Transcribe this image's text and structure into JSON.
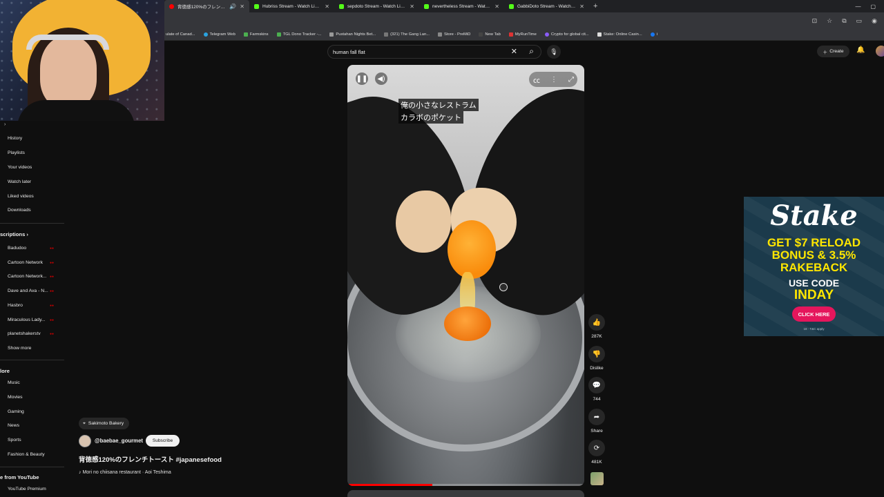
{
  "browser": {
    "tabs": [
      {
        "title": "背徳感120%のフレンチトースト",
        "favicon": "youtube-icon",
        "active": true
      },
      {
        "title": "Hubriss Stream - Watch Live o",
        "favicon": "kick-icon",
        "active": false
      },
      {
        "title": "sepdoto Stream - Watch Live o",
        "favicon": "kick-icon",
        "active": false
      },
      {
        "title": "nevertheless Stream - Watch Li",
        "favicon": "kick-icon",
        "active": false
      },
      {
        "title": "GabbiDoto Stream - Watch Live",
        "favicon": "kick-icon",
        "active": false
      }
    ],
    "new_tab": "+",
    "bookmarks": [
      "ulate of Canad...",
      "Telegram Web",
      "Farmskins",
      "TGL Dono Tracker -...",
      "Pustahan Nights Bet...",
      "(321) The Gang Lan...",
      "Store - PreMiD",
      "New Tab",
      "MyRunTime",
      "Crypto for global cit...",
      "Stake: Online Casin...",
      "i"
    ]
  },
  "masthead": {
    "search_value": "human fall flat",
    "create_label": "Create"
  },
  "sidebar": {
    "you_items": [
      "History",
      "Playlists",
      "Your videos",
      "Watch later",
      "Liked videos",
      "Downloads"
    ],
    "subscriptions_title": "scriptions",
    "subscriptions": [
      "Badudoo",
      "Cartoon Network",
      "Cartoon Network...",
      "Dave and Ava - N...",
      "Hasbro",
      "Miraculous Lady...",
      "planetshakerstv"
    ],
    "show_more": "Show more",
    "explore_title": "lore",
    "explore": [
      "Music",
      "Movies",
      "Gaming",
      "News",
      "Sports",
      "Fashion & Beauty"
    ],
    "more_title": "e from YouTube",
    "more": [
      "YouTube Premium"
    ]
  },
  "video": {
    "subtitles": [
      "俺の小さなレストラム",
      "カラボのポケット"
    ],
    "progress": 0.36
  },
  "info": {
    "location": "Sakimoto Bakery",
    "channel": "@baebae_gourmet",
    "subscribe": "Subscribe",
    "title": "背徳感120%のフレンチトースト #japanesefood",
    "music": "Mori no chiisana restaurant · Aoi Teshima"
  },
  "actions": {
    "likes": "287K",
    "dislike": "Dislike",
    "comments": "744",
    "share": "Share",
    "remix": "481K"
  },
  "ad": {
    "brand": "Stake",
    "line1": "GET $7 RELOAD",
    "line2": "BONUS & 3.5%",
    "line3": "RAKEBACK",
    "use_code": "USE CODE",
    "code": "INDAY",
    "cta": "CLICK HERE",
    "fine": "18 · T&C apply"
  },
  "colors": {
    "accent_red": "#ff0000",
    "ad_yellow": "#ffe600",
    "ad_button": "#e5165c"
  }
}
